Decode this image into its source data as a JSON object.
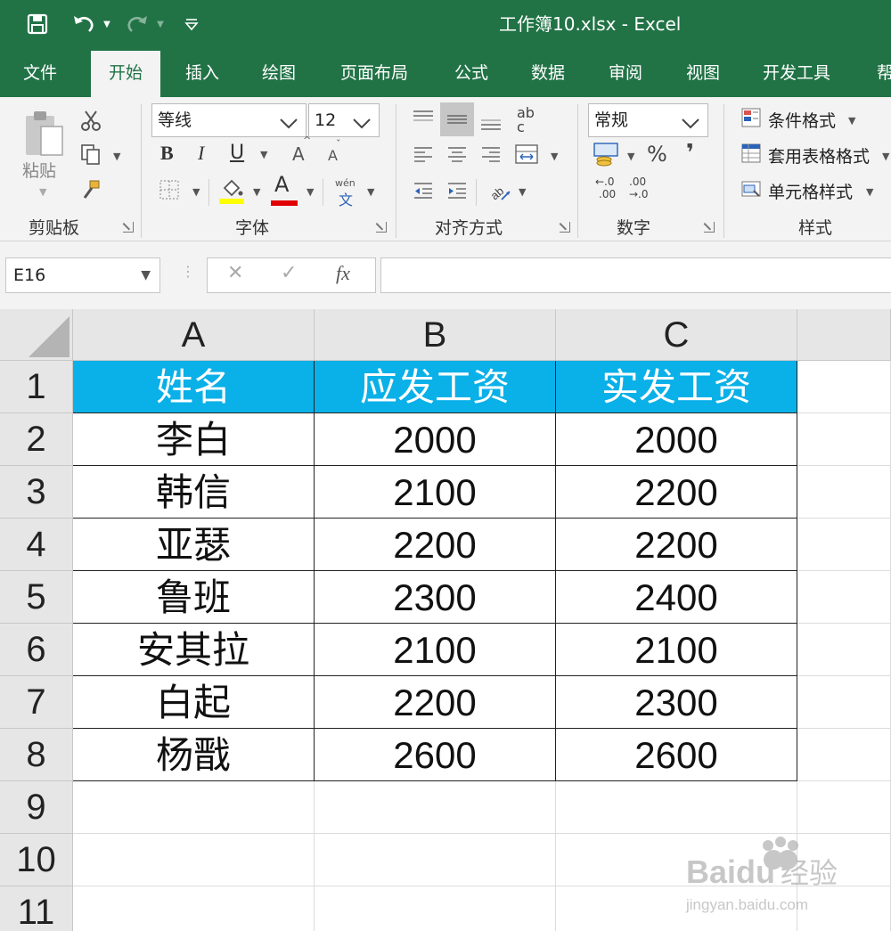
{
  "app": {
    "title": "工作簿10.xlsx  -  Excel",
    "accent_color": "#217346",
    "header_fill_color": "#0ab0e8"
  },
  "quick_access": {
    "save_icon": "save-icon",
    "undo_icon": "undo-icon",
    "redo_icon": "redo-icon",
    "customize_icon": "customize-qat-icon"
  },
  "tabs": [
    "文件",
    "开始",
    "插入",
    "绘图",
    "页面布局",
    "公式",
    "数据",
    "审阅",
    "视图",
    "开发工具",
    "帮"
  ],
  "active_tab": "开始",
  "ribbon": {
    "clipboard": {
      "paste_label": "粘贴",
      "group_label": "剪贴板"
    },
    "font": {
      "font_name": "等线",
      "font_size": "12",
      "bold": "B",
      "italic": "I",
      "underline": "U",
      "increase_a": "A",
      "decrease_a": "A",
      "font_color_a": "A",
      "wen": "wén",
      "wen_char": "文",
      "group_label": "字体"
    },
    "alignment": {
      "ab": "ab",
      "c": "c",
      "group_label": "对齐方式"
    },
    "number": {
      "format": "常规",
      "percent": "%",
      "comma": "❜",
      "dec_inc_top": "←.0",
      "dec_inc_bottom": ".00",
      "dec_dec_top": ".00",
      "dec_dec_bottom": "→.0",
      "group_label": "数字"
    },
    "styles": {
      "conditional": "条件格式",
      "table": "套用表格格式",
      "cell_styles": "单元格样式",
      "group_label": "样式"
    }
  },
  "formula_bar": {
    "name_box": "E16",
    "cancel": "✕",
    "enter": "✓",
    "fx": "fx",
    "value": ""
  },
  "sheet": {
    "columns": [
      "A",
      "B",
      "C"
    ],
    "rows": [
      "1",
      "2",
      "3",
      "4",
      "5",
      "6",
      "7",
      "8",
      "9",
      "10",
      "11"
    ],
    "headers": [
      "姓名",
      "应发工资",
      "实发工资"
    ],
    "data": [
      [
        "李白",
        "2000",
        "2000"
      ],
      [
        "韩信",
        "2100",
        "2200"
      ],
      [
        "亚瑟",
        "2200",
        "2200"
      ],
      [
        "鲁班",
        "2300",
        "2400"
      ],
      [
        "安其拉",
        "2100",
        "2100"
      ],
      [
        "白起",
        "2200",
        "2300"
      ],
      [
        "杨戬",
        "2600",
        "2600"
      ]
    ]
  },
  "watermark": {
    "brand": "Baidu",
    "cn": "经验",
    "url": "jingyan.baidu.com"
  }
}
